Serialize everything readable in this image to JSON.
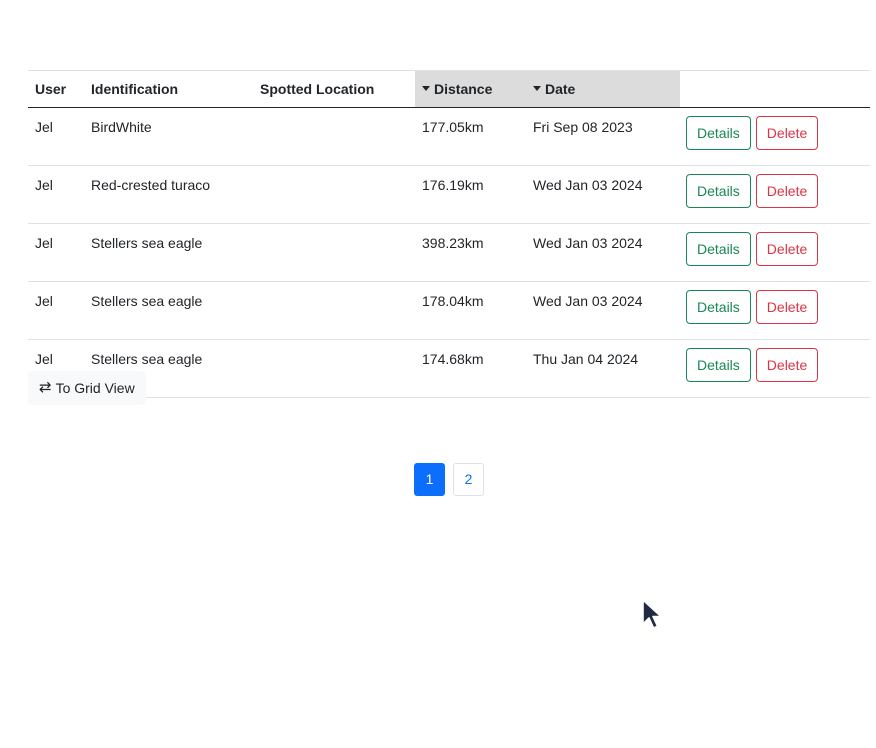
{
  "table": {
    "headers": {
      "user": "User",
      "identification": "Identification",
      "spotted_location": "Spotted Location",
      "distance": "Distance",
      "date": "Date"
    },
    "rows": [
      {
        "user": "Jel",
        "identification": "BirdWhite",
        "spotted_location": "",
        "distance": "177.05km",
        "date": "Fri Sep 08 2023"
      },
      {
        "user": "Jel",
        "identification": "Red-crested turaco",
        "spotted_location": "",
        "distance": "176.19km",
        "date": "Wed Jan 03 2024"
      },
      {
        "user": "Jel",
        "identification": "Stellers sea eagle",
        "spotted_location": "",
        "distance": "398.23km",
        "date": "Wed Jan 03 2024"
      },
      {
        "user": "Jel",
        "identification": "Stellers sea eagle",
        "spotted_location": "",
        "distance": "178.04km",
        "date": "Wed Jan 03 2024"
      },
      {
        "user": "Jel",
        "identification": "Stellers sea eagle",
        "spotted_location": "",
        "distance": "174.68km",
        "date": "Thu Jan 04 2024"
      }
    ],
    "details_label": "Details",
    "delete_label": "Delete"
  },
  "grid_toggle": {
    "label": "To Grid View",
    "icon": "swap-arrows-icon"
  },
  "pagination": {
    "pages": [
      "1",
      "2"
    ],
    "active_page": "1"
  },
  "colors": {
    "details": "#198754",
    "delete": "#dc3545",
    "active_page": "#0d6efd",
    "sorted_header_bg": "#dcdcdc"
  }
}
